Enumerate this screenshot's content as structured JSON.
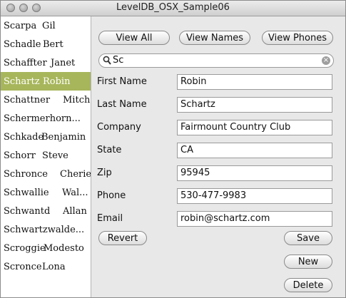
{
  "window": {
    "title": "LevelDB_OSX_Sample06"
  },
  "sidebar": {
    "items": [
      {
        "last": "Scarpa",
        "first": "Gil",
        "selected": false
      },
      {
        "last": "Schadle",
        "first": "Bert",
        "selected": false
      },
      {
        "last": "Schaffter",
        "first": "Janet",
        "selected": false
      },
      {
        "last": "Schartz",
        "first": "Robin",
        "selected": true
      },
      {
        "last": "Schattner",
        "first": "Mitch",
        "selected": false
      },
      {
        "last": "Schermerhorn...",
        "first": "",
        "selected": false
      },
      {
        "last": "Schkade",
        "first": "Benjamin",
        "selected": false
      },
      {
        "last": "Schorr",
        "first": "Steve",
        "selected": false
      },
      {
        "last": "Schronce",
        "first": "Cherie",
        "selected": false
      },
      {
        "last": "Schwallie",
        "first": "Wal...",
        "selected": false
      },
      {
        "last": "Schwantd",
        "first": "Allan",
        "selected": false
      },
      {
        "last": "Schwartzwalde...",
        "first": "",
        "selected": false
      },
      {
        "last": "Scroggie",
        "first": "Modesto",
        "selected": false
      },
      {
        "last": "Scronce",
        "first": "Lona",
        "selected": false
      }
    ]
  },
  "toolbar": {
    "view_all": "View All",
    "view_names": "View Names",
    "view_phones": "View Phones"
  },
  "search": {
    "value": "Sc"
  },
  "form": {
    "first_name": {
      "label": "First Name",
      "value": "Robin"
    },
    "last_name": {
      "label": "Last Name",
      "value": "Schartz"
    },
    "company": {
      "label": "Company",
      "value": "Fairmount Country Club"
    },
    "state": {
      "label": "State",
      "value": "CA"
    },
    "zip": {
      "label": "Zip",
      "value": "95945"
    },
    "phone": {
      "label": "Phone",
      "value": "530-477-9983"
    },
    "email": {
      "label": "Email",
      "value": "robin@schartz.com"
    }
  },
  "actions": {
    "revert": "Revert",
    "save": "Save",
    "new": "New",
    "delete": "Delete"
  },
  "colors": {
    "selection": "#a7b65b"
  }
}
